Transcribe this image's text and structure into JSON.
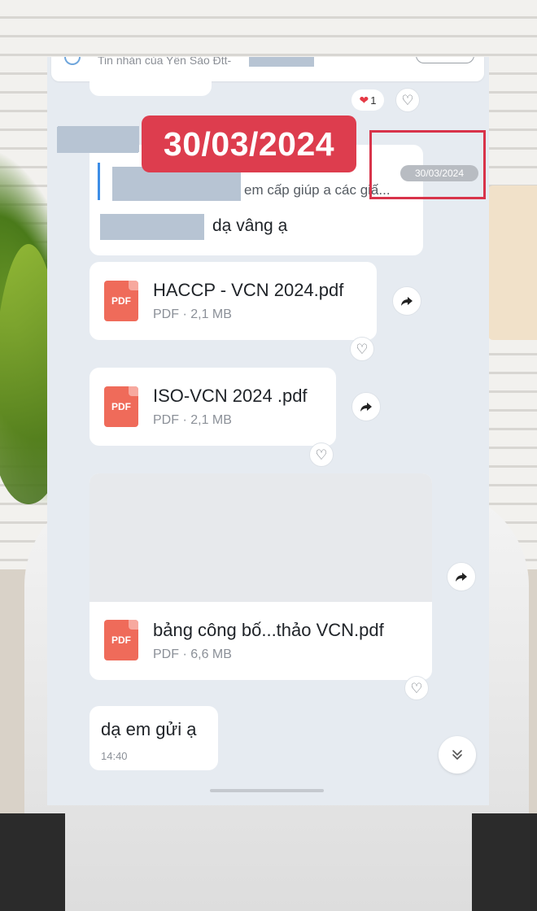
{
  "header": {
    "title": "Tin nhắn của Yến Sào Đtt-"
  },
  "reaction": {
    "count": "1"
  },
  "date_banner": "30/03/2024",
  "reply_message": {
    "quote_text": "em cấp giúp a các giấ...",
    "timestamp": "30/03/2024",
    "text": "dạ vâng ạ"
  },
  "files": [
    {
      "icon_label": "PDF",
      "name": "HACCP - VCN 2024.pdf",
      "meta": "PDF · 2,1 MB"
    },
    {
      "icon_label": "PDF",
      "name": "ISO-VCN 2024 .pdf",
      "meta": "PDF · 2,1 MB"
    },
    {
      "icon_label": "PDF",
      "name": "bảng công bố...thảo VCN.pdf",
      "meta": "PDF · 6,6 MB"
    }
  ],
  "last_message": {
    "text": "dạ em gửi ạ",
    "time": "14:40"
  },
  "icons": {
    "chat": "chat-bubble-icon",
    "like": "heart-outline-icon",
    "share": "share-arrow-icon",
    "scroll": "double-chevron-down-icon"
  },
  "colors": {
    "banner": "#dd3d4e",
    "highlight": "#d8334a",
    "pdf": "#ef6b5a",
    "chat_bg": "#e6ebf1"
  }
}
